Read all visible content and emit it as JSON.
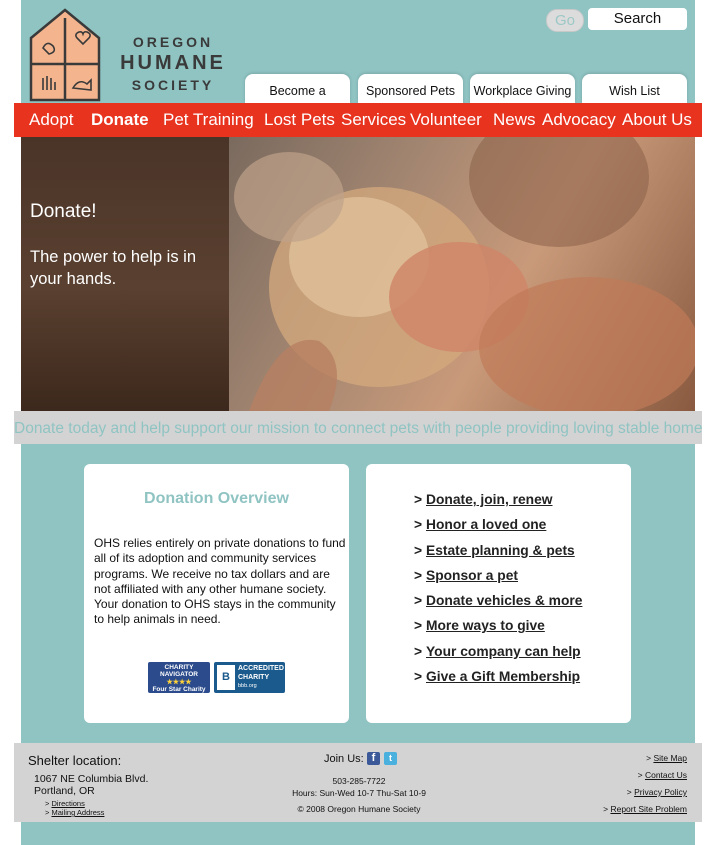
{
  "header": {
    "logo_lines": [
      "OREGON",
      "HUMANE",
      "SOCIETY"
    ],
    "go_label": "Go",
    "search_label": "Search",
    "top_tabs": [
      "Become a Member",
      "Sponsored Pets",
      "Workplace Giving",
      "Wish List"
    ]
  },
  "nav": {
    "items": [
      "Adopt",
      "Donate",
      "Pet Training",
      "Lost Pets",
      "Services",
      "Volunteer",
      "News",
      "Advocacy",
      "About Us"
    ],
    "active": "Donate"
  },
  "hero": {
    "title": "Donate!",
    "tagline": "The power to help is in your hands."
  },
  "banner": {
    "text": "Donate today and help support our mission to connect pets with people providing loving stable homes"
  },
  "overview": {
    "title": "Donation Overview",
    "body": "OHS relies entirely on private donations to fund all of its adoption and community services programs.  We receive no tax dollars and are not affiliated with any other humane society.  Your donation to OHS stays in the community to help animals in need.",
    "badges": {
      "charity_navigator": [
        "CHARITY",
        "NAVIGATOR",
        "★★★★",
        "Four Star Charity"
      ],
      "bbb": [
        "ACCREDITED",
        "CHARITY",
        "bbb.org"
      ]
    }
  },
  "links": {
    "arrow": ">",
    "items": [
      "Donate, join, renew",
      "Honor a loved one",
      "Estate planning & pets",
      "Sponsor a pet",
      "Donate vehicles & more",
      "More ways to give",
      "Your company can help",
      "Give a Gift Membership"
    ]
  },
  "footer": {
    "shelter_title": "Shelter location:",
    "address_line1": "1067 NE Columbia Blvd.",
    "address_line2": "Portland, OR",
    "directions": "Directions",
    "mailing_address": "Mailing Address",
    "link_prefix": ">",
    "join_label": "Join Us:",
    "phone": "503-285-7722",
    "hours": "Hours: Sun-Wed 10-7  Thu-Sat 10-9",
    "copyright": "© 2008 Oregon Humane Society",
    "right_links": [
      "Site Map",
      "Contact Us",
      "Privacy Policy",
      "Report Site Problem"
    ]
  },
  "colors": {
    "teal": "#8fc4c3",
    "nav_red": "#e8331f",
    "banner_gray": "#d3d3d3",
    "logo_orange": "#f4b58e"
  }
}
